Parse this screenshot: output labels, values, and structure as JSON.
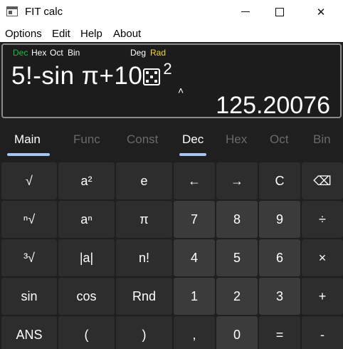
{
  "window": {
    "title": "FIT calc",
    "minimize_glyph": "—",
    "maximize_glyph": "☐",
    "close_glyph": "✕"
  },
  "menu": [
    "Options",
    "Edit",
    "Help",
    "About"
  ],
  "display": {
    "modes": {
      "dec": "Dec",
      "hex": "Hex",
      "oct": "Oct",
      "bin": "Bin",
      "deg": "Deg",
      "rad": "Rad"
    },
    "active_base": "Dec",
    "active_angle": "Rad",
    "expression": "5!-sin π+10",
    "expression_suffix_icon": "dice-icon",
    "exponent": "2",
    "caret": "˄",
    "result": "125.20076"
  },
  "tabs": {
    "left": [
      {
        "label": "Main",
        "active": true
      },
      {
        "label": "Func",
        "active": false
      },
      {
        "label": "Const",
        "active": false
      }
    ],
    "right": [
      {
        "label": "Dec",
        "active": true
      },
      {
        "label": "Hex",
        "active": false
      },
      {
        "label": "Oct",
        "active": false
      },
      {
        "label": "Bin",
        "active": false
      }
    ],
    "underline_color": "#a8c4f0"
  },
  "keys": [
    [
      "√",
      "a²",
      "e",
      "←",
      "→",
      "C",
      "⌫"
    ],
    [
      "ⁿ√",
      "aⁿ",
      "π",
      "7",
      "8",
      "9",
      "÷"
    ],
    [
      "³√",
      "|a|",
      "n!",
      "4",
      "5",
      "6",
      "×"
    ],
    [
      "sin",
      "cos",
      "Rnd",
      "1",
      "2",
      "3",
      "+"
    ],
    [
      "ANS",
      "(",
      ")",
      ",",
      "0",
      "=",
      "-"
    ]
  ],
  "colors": {
    "key_function": "#2d2d2d",
    "key_number": "#3b3b3b",
    "base_active": "#22b84a",
    "angle_active": "#f2d43a"
  }
}
